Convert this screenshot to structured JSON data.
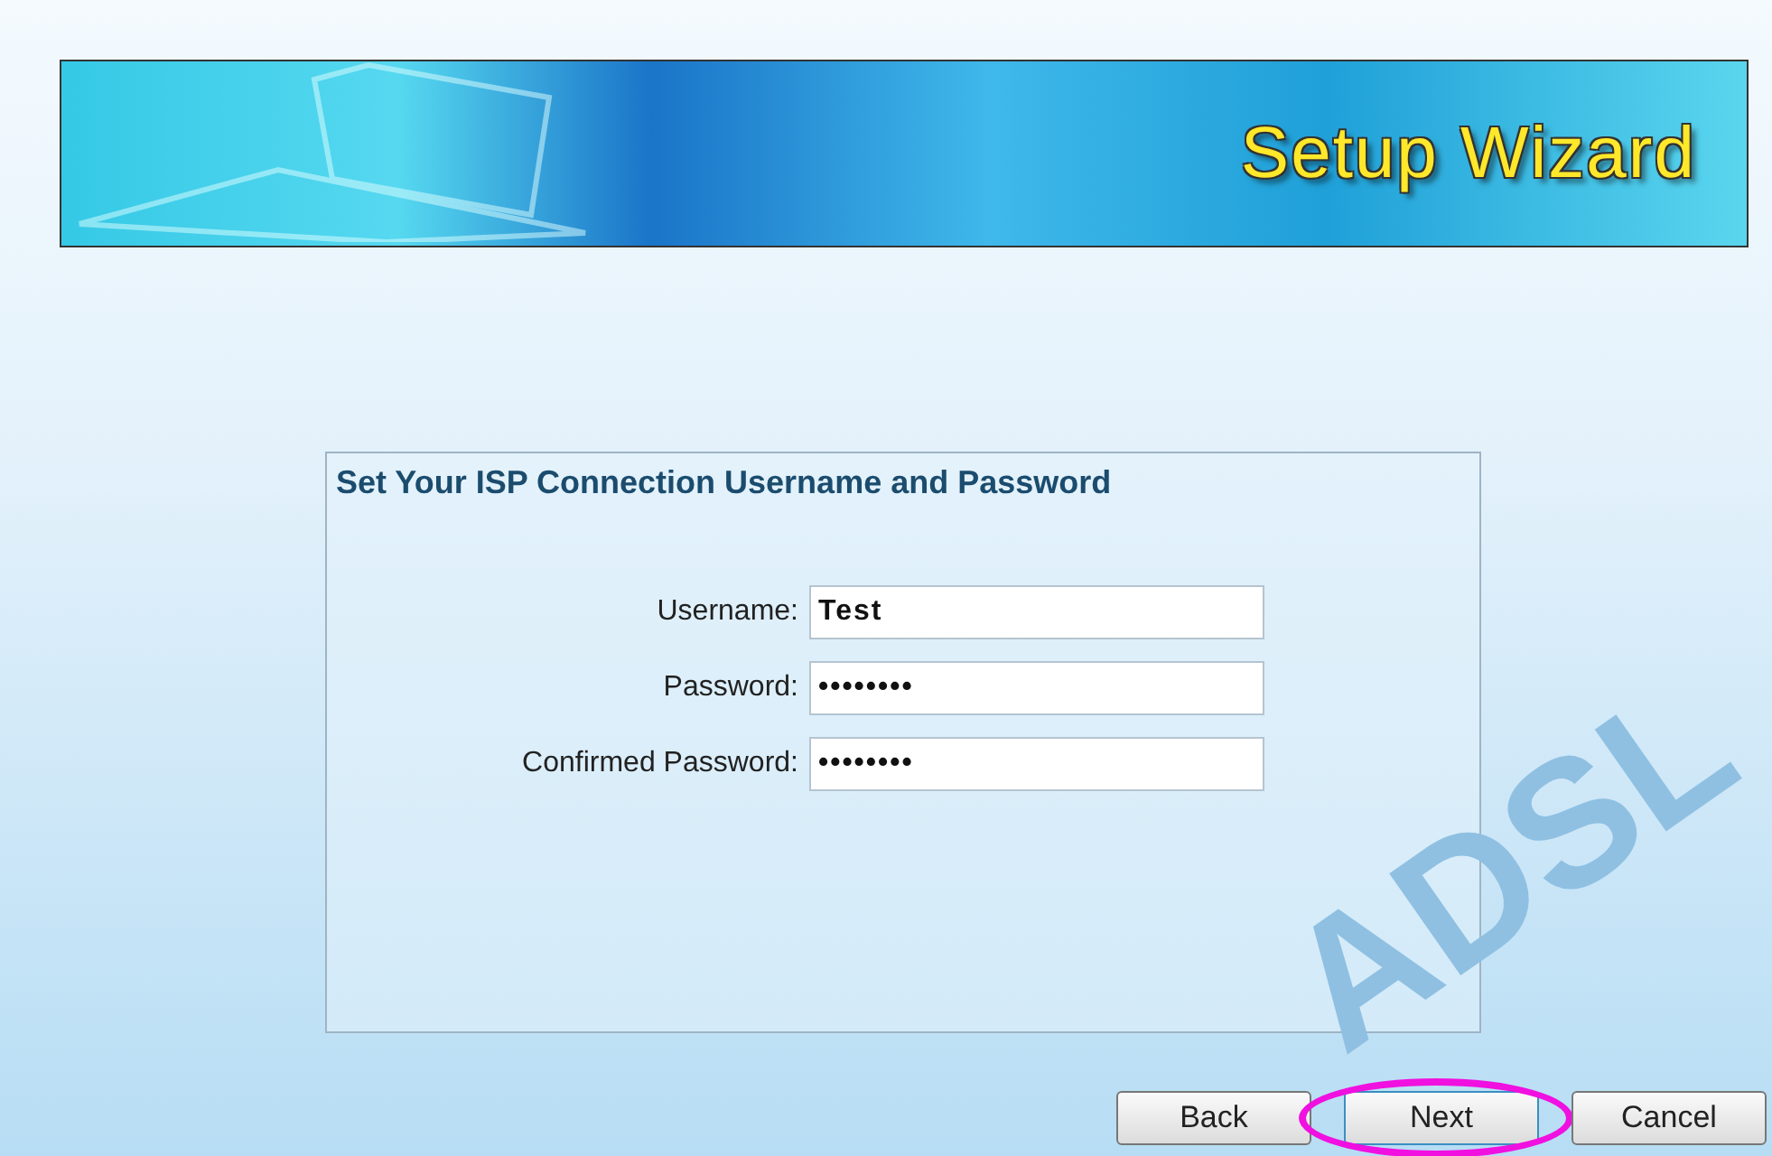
{
  "banner": {
    "title": "Setup Wizard"
  },
  "background_art": "ADSL",
  "panel": {
    "title": "Set Your ISP Connection Username and Password",
    "fields": [
      {
        "label": "Username:",
        "value": "Test"
      },
      {
        "label": "Password:",
        "value": "••••••••"
      },
      {
        "label": "Confirmed Password:",
        "value": "••••••••"
      }
    ]
  },
  "buttons": [
    {
      "label": "Back",
      "highlighted": false
    },
    {
      "label": "Next",
      "highlighted": true
    },
    {
      "label": "Cancel",
      "highlighted": false
    }
  ]
}
